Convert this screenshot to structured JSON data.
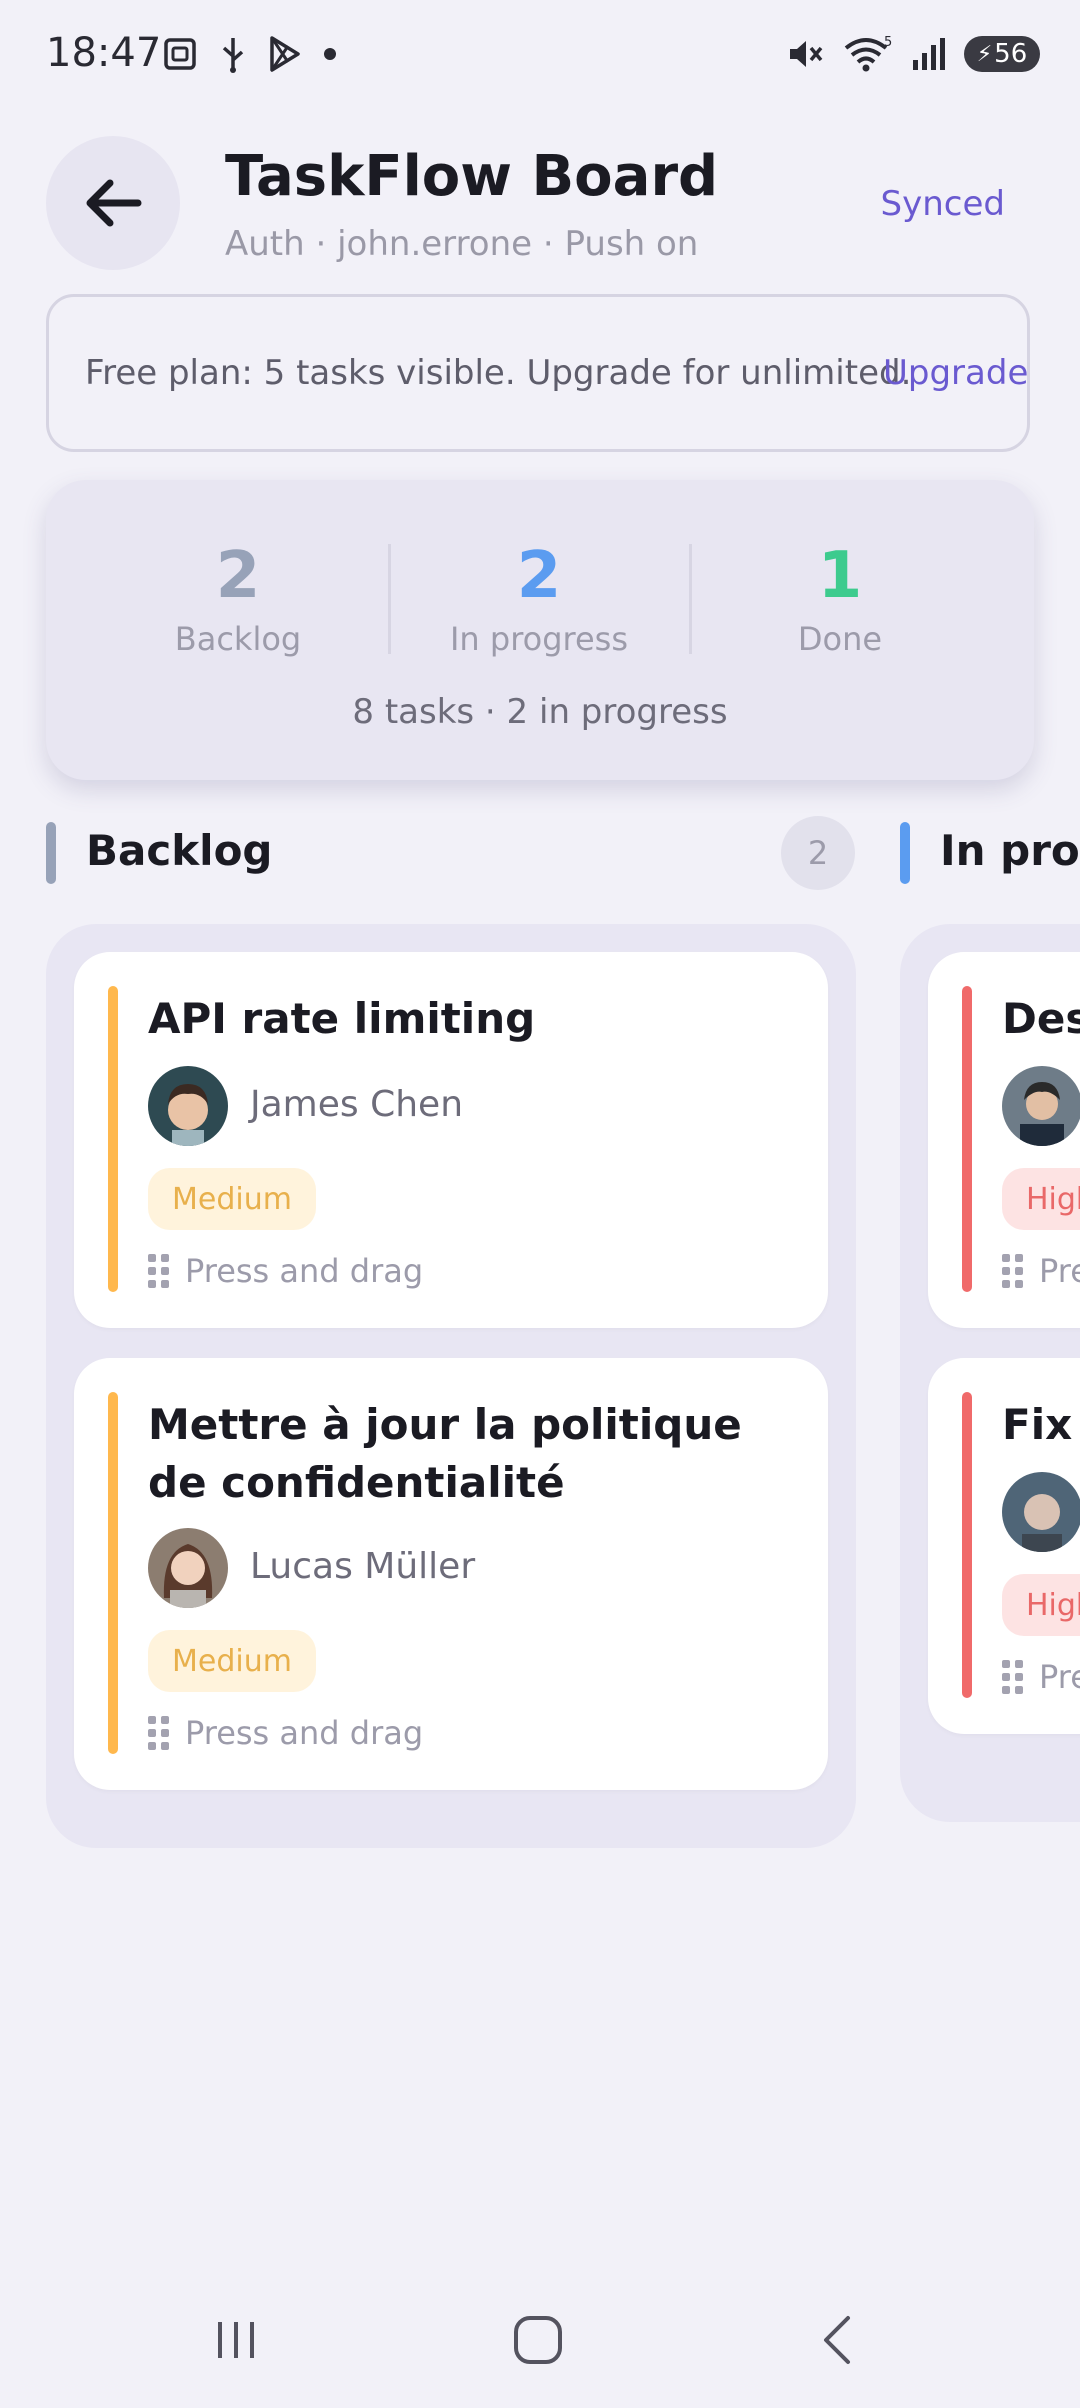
{
  "status_bar": {
    "time": "18:47",
    "battery": "56",
    "left_icons": [
      "screenshot-icon",
      "usb-icon",
      "play-store-icon",
      "dot-icon"
    ],
    "right_icons": [
      "mute-icon",
      "wifi-icon",
      "signal-icon",
      "battery-icon"
    ]
  },
  "header": {
    "title": "TaskFlow Board",
    "subtitle": "Auth · john.errone · Push on",
    "sync_status": "Synced"
  },
  "banner": {
    "text": "Free plan: 5 tasks visible. Upgrade for unlimited.",
    "link": "Upgrade"
  },
  "stats": {
    "items": [
      {
        "value": "2",
        "label": "Backlog",
        "color": "#97A2B8"
      },
      {
        "value": "2",
        "label": "In progress",
        "color": "#5B9CF0"
      },
      {
        "value": "1",
        "label": "Done",
        "color": "#3DCB8E"
      }
    ],
    "summary": "8 tasks · 2 in progress"
  },
  "columns": [
    {
      "title": "Backlog",
      "count": "2",
      "accent": "#97A2B8",
      "cards": [
        {
          "title": "API rate limiting",
          "assignee": "James Chen",
          "priority": "Medium",
          "drag_hint": "Press and drag"
        },
        {
          "title": "Mettre à jour la politique de confidentialité",
          "assignee": "Lucas Müller",
          "priority": "Medium",
          "drag_hint": "Press and drag"
        }
      ]
    },
    {
      "title": "In progress",
      "accent": "#5B9CF0",
      "cards": [
        {
          "title": "Des",
          "priority": "High",
          "drag_hint": "Pre"
        },
        {
          "title": "Fix p",
          "priority": "High",
          "drag_hint": "Pre"
        }
      ]
    }
  ],
  "colors": {
    "brand": "#6A5AD0",
    "medium": "#FFB84D",
    "high": "#F06A6A",
    "background": "#F2F1F8"
  }
}
